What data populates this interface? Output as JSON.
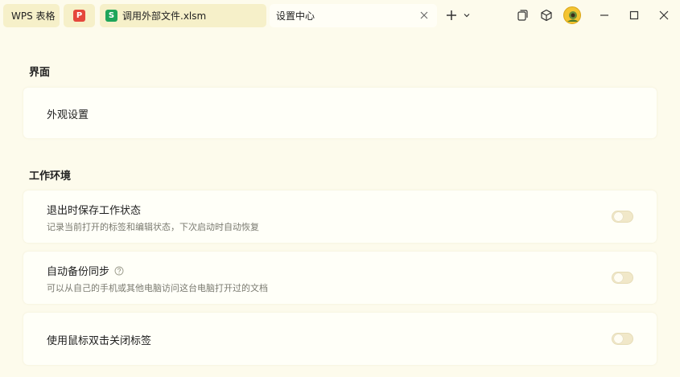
{
  "titlebar": {
    "home_tab": "WPS 表格",
    "pdf_badge": "P",
    "file_badge": "S",
    "file_tab": "调用外部文件.xlsm",
    "settings_tab": "设置中心"
  },
  "sections": [
    {
      "title": "界面",
      "items": [
        {
          "title": "外观设置"
        }
      ]
    },
    {
      "title": "工作环境",
      "items": [
        {
          "title": "退出时保存工作状态",
          "desc": "记录当前打开的标签和编辑状态，下次启动时自动恢复",
          "toggle": false
        },
        {
          "title": "自动备份同步",
          "desc": "可以从自己的手机或其他电脑访问这台电脑打开过的文档",
          "toggle": false
        },
        {
          "title": "使用鼠标双击关闭标签",
          "toggle": false
        }
      ]
    }
  ],
  "colors": {
    "background": "#fdfbec",
    "tab_inactive": "#f6f0c9",
    "card": "#fffff8",
    "toggle_off": "#f1e8c9"
  }
}
